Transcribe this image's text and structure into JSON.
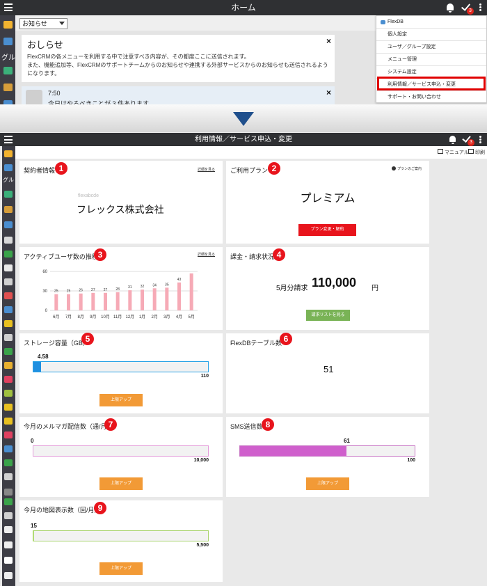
{
  "top": {
    "title": "ホーム",
    "badge": "3",
    "sidebar_label": "グル",
    "dropdown_value": "お知らせ",
    "notice": {
      "title": "おしらせ",
      "body": "FlexCRMの各メニューを利用する中で注意すべき内容が、その都度ここに送信されます。\nまた、機能追加等、FlexCRMのサポートチームからのお知らせや連携する外部サービスからのお知らせも送信されるようになります。"
    },
    "todo": {
      "time": "7:50",
      "message": "今日はやるべきことが 3 件あります"
    },
    "menu": {
      "header": "FlexDB",
      "items": [
        "個人設定",
        "ユーザ／グループ設定",
        "メニュー管理",
        "システム設定",
        "利用情報／サービス申込・変更",
        "サポート・お問い合わせ"
      ]
    }
  },
  "bottom": {
    "title": "利用情報／サービス申込・変更",
    "badge": "3",
    "sidebar_label": "グル",
    "toolbar": {
      "manual": "マニュアル",
      "print": "印刷"
    },
    "cards": {
      "contract": {
        "title": "契約者情報",
        "num": "1",
        "link": "詳細を見る",
        "company_small": "flexabcde",
        "company": "フレックス株式会社"
      },
      "plan": {
        "title": "ご利用プラン",
        "num": "2",
        "help": "プランのご案内",
        "value": "プレミアム",
        "button": "プラン変更・解約"
      },
      "active": {
        "title": "アクティブユーザ数の推移",
        "num": "3",
        "link": "詳細を見る"
      },
      "billing": {
        "title": "課金・請求状況",
        "num": "4",
        "prefix": "5月分請求",
        "amount": "110,000",
        "unit": "円",
        "button": "請求リストを見る"
      },
      "storage": {
        "title": "ストレージ容量（GB）",
        "num": "5",
        "value": "4.58",
        "max": "110",
        "button": "上限アップ"
      },
      "flexdb": {
        "title": "FlexDBテーブル数",
        "num": "6",
        "value": "51"
      },
      "mail": {
        "title": "今月のメルマガ配信数（通/月）",
        "num": "7",
        "value": "0",
        "max": "10,000",
        "button": "上限アップ"
      },
      "sms": {
        "title": "SMS送信数",
        "num": "8",
        "value": "61",
        "max": "100",
        "button": "上限アップ"
      },
      "map": {
        "title": "今月の地図表示数（回/月）",
        "num": "9",
        "value": "15",
        "max": "5,500",
        "button": "上限アップ"
      }
    }
  },
  "bars": {
    "storage": {
      "fraction": 0.042,
      "color": "#1f8fe0",
      "border": "#2aa3e6"
    },
    "mail": {
      "fraction": 0.0,
      "color": "#d86dd0",
      "border": "#e39ad9"
    },
    "sms": {
      "fraction": 0.61,
      "color": "#cf5fcc",
      "border": "#c774c4"
    },
    "map": {
      "fraction": 0.003,
      "color": "#b6e07a",
      "border": "#a9d36d"
    }
  },
  "chart_data": {
    "type": "bar",
    "categories": [
      "6月",
      "7月",
      "8月",
      "9月",
      "10月",
      "11月",
      "12月",
      "1月",
      "2月",
      "3月",
      "4月",
      "5月"
    ],
    "values": [
      25,
      25,
      26,
      27,
      27,
      28,
      31,
      32,
      34,
      35,
      43,
      57
    ],
    "labels": [
      "25",
      "25",
      "26",
      "27",
      "27",
      "28",
      "31",
      "32",
      "34",
      "35",
      "43",
      ""
    ],
    "yticks": [
      "60",
      "30",
      "0"
    ],
    "ylim": [
      0,
      60
    ],
    "color": "#f6aab6"
  }
}
